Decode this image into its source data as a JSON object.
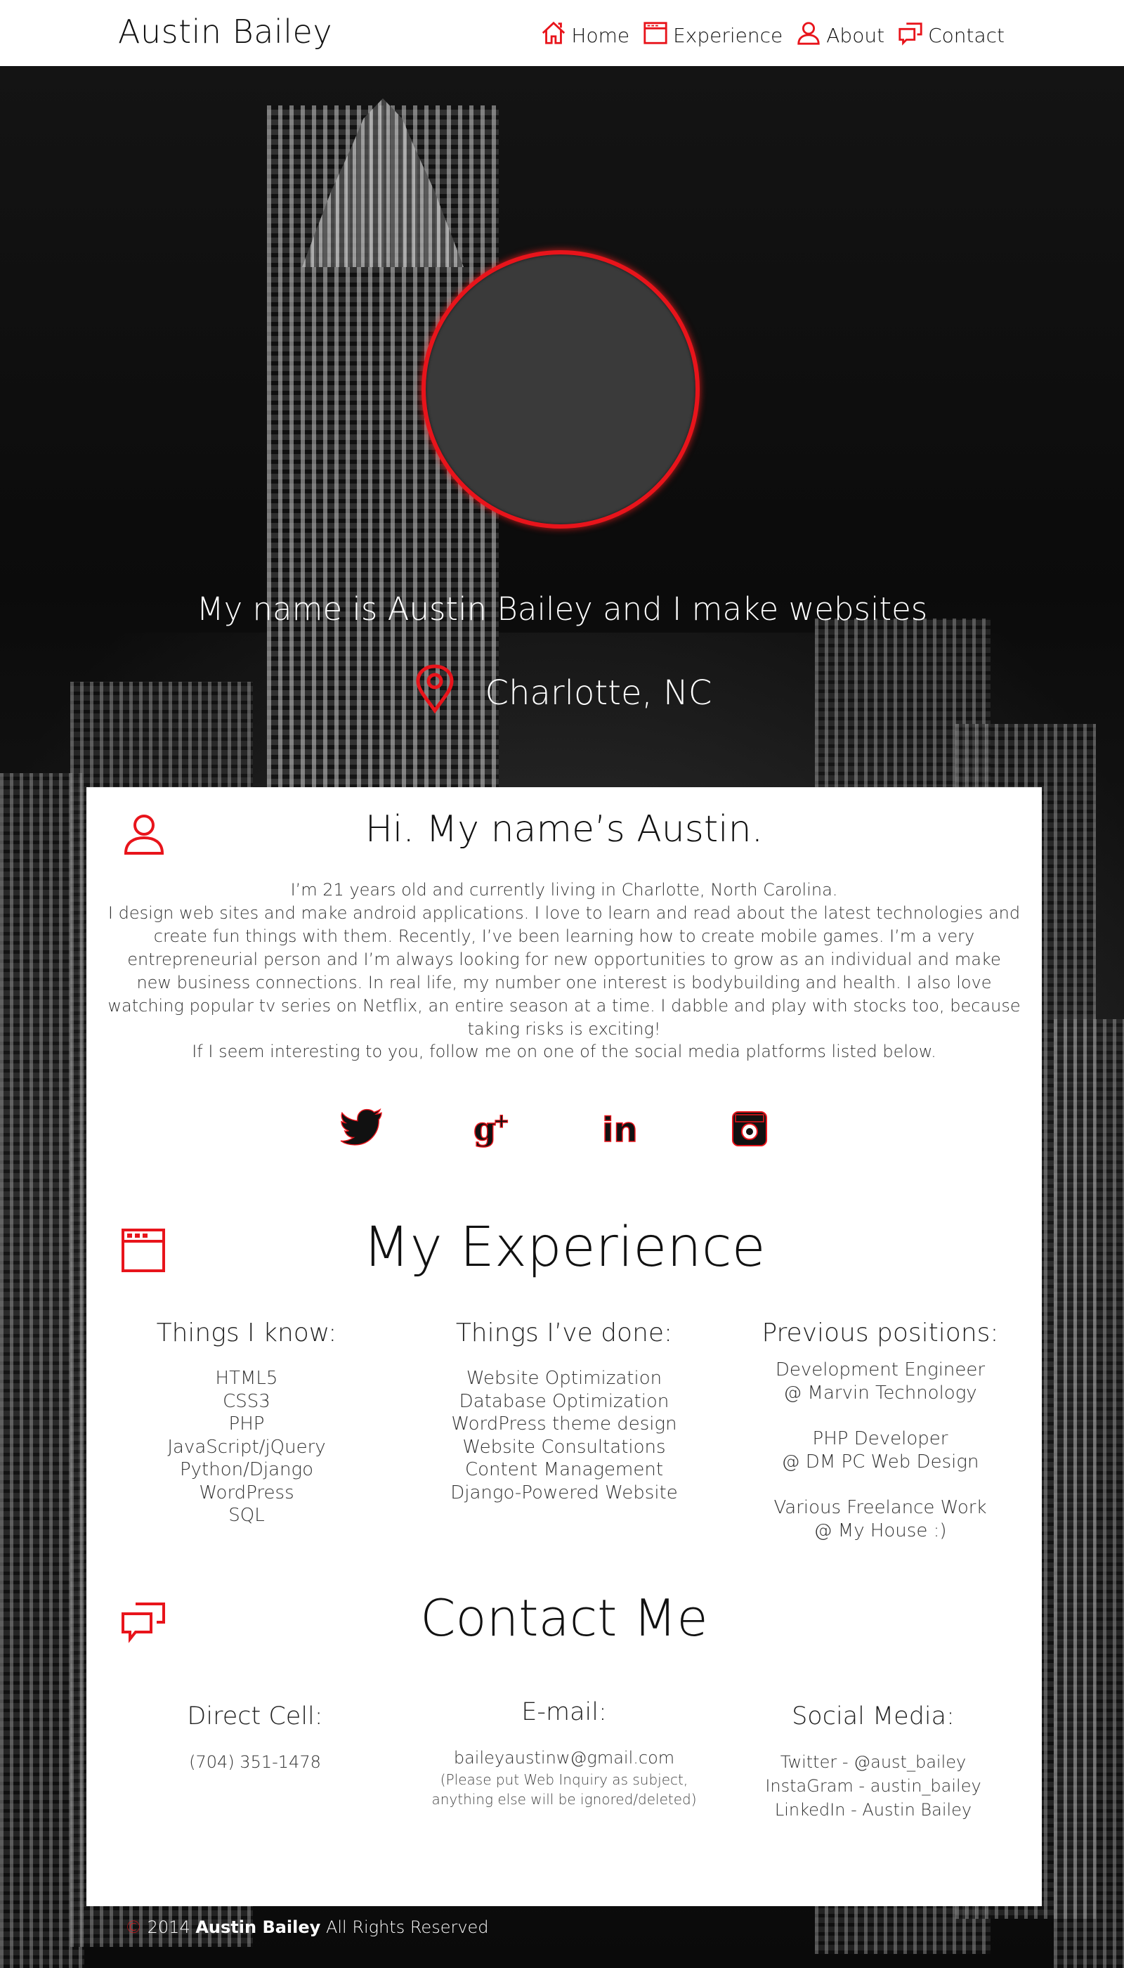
{
  "brand": "Austin Bailey",
  "nav": {
    "home": "Home",
    "experience": "Experience",
    "about": "About",
    "contact": "Contact"
  },
  "hero": {
    "tagline": "My name is Austin Bailey and I make websites",
    "location": "Charlotte, NC"
  },
  "about": {
    "title": "Hi. My name’s Austin.",
    "line1": "I’m 21 years old and currently living in Charlotte, North Carolina.",
    "body": "I design web sites and make android applications. I love to learn and read about the latest technologies and create fun things with them. Recently, I’ve been learning how to create mobile games. I’m a very entrepreneurial person and I’m always looking for new opportunities to grow as an individual and make new business connections. In real life, my number one interest is bodybuilding and health. I also love watching popular tv series on Netflix, an entire season at a time. I dabble and play with stocks too, because taking risks is exciting!",
    "follow": "If I seem interesting to you, follow me on one of the social media platforms listed below."
  },
  "social_icons": [
    "twitter-icon",
    "google-plus-icon",
    "linkedin-icon",
    "instagram-icon"
  ],
  "experience": {
    "title": "My Experience",
    "know": {
      "heading": "Things I know:",
      "items": [
        "HTML5",
        "CSS3",
        "PHP",
        "JavaScript/jQuery",
        "Python/Django",
        "WordPress",
        "SQL"
      ]
    },
    "done": {
      "heading": "Things I’ve done:",
      "items": [
        "Website Optimization",
        "Database Optimization",
        "WordPress theme design",
        "Website Consultations",
        "Content Management",
        "Django-Powered Website"
      ]
    },
    "positions": {
      "heading": "Previous positions:",
      "items": [
        {
          "role": "Development Engineer",
          "place": "@ Marvin Technology"
        },
        {
          "role": "PHP Developer",
          "place": "@ DM PC Web Design"
        },
        {
          "role": "Various Freelance Work",
          "place": "@ My House :)"
        }
      ]
    }
  },
  "contact": {
    "title": "Contact Me",
    "cell": {
      "heading": "Direct Cell:",
      "value": "(704) 351-1478"
    },
    "email": {
      "heading": "E-mail:",
      "value": "baileyaustinw@gmail.com",
      "note": "(Please put Web Inquiry as subject, anything else will be ignored/deleted)"
    },
    "social": {
      "heading": "Social Media:",
      "twitter": "Twitter - @aust_bailey",
      "instagram": "InstaGram - austin_bailey",
      "linkedin": "LinkedIn - Austin Bailey"
    }
  },
  "footer": {
    "copyright_symbol": "©",
    "year": "2014",
    "name": "Austin Bailey",
    "rights": "All Rights Reserved"
  },
  "colors": {
    "accent": "#e8141b",
    "panel": "#ffffff",
    "background": "#0b0b0b"
  }
}
